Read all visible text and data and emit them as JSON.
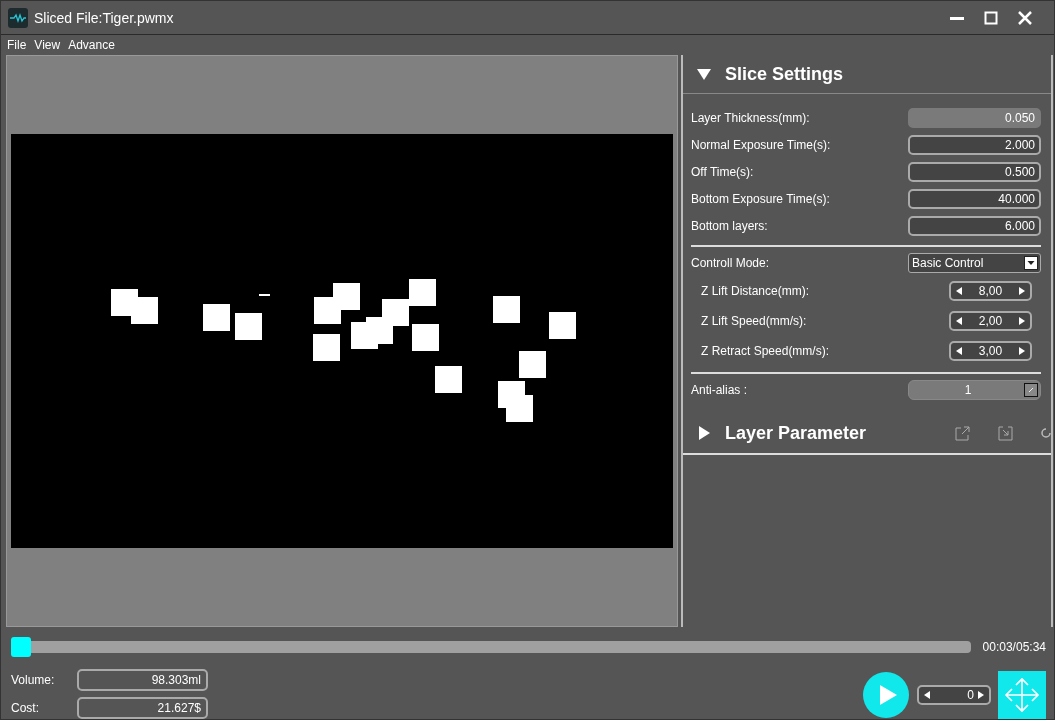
{
  "window": {
    "title": "Sliced File:Tiger.pwmx"
  },
  "menu": [
    "File",
    "View",
    "Advance"
  ],
  "slice_settings": {
    "title": "Slice Settings",
    "expanded": true,
    "fields": [
      {
        "label": "Layer Thickness(mm):",
        "value": "0.050",
        "disabled": true
      },
      {
        "label": "Normal Exposure Time(s):",
        "value": "2.000",
        "disabled": false
      },
      {
        "label": "Off Time(s):",
        "value": "0.500",
        "disabled": false
      },
      {
        "label": "Bottom Exposure Time(s):",
        "value": "40.000",
        "disabled": false
      },
      {
        "label": "Bottom layers:",
        "value": "6.000",
        "disabled": false
      }
    ],
    "control_mode": {
      "label": "Controll Mode:",
      "value": "Basic Control",
      "disabled": false
    },
    "spinners": [
      {
        "label": "Z Lift Distance(mm):",
        "value": "8,00"
      },
      {
        "label": "Z Lift Speed(mm/s):",
        "value": "2,00"
      },
      {
        "label": "Z Retract Speed(mm/s):",
        "value": "3,00"
      }
    ],
    "anti_alias": {
      "label": "Anti-alias :",
      "value": "1",
      "disabled": true
    }
  },
  "layer_parameter": {
    "title": "Layer Parameter",
    "expanded": false
  },
  "playback": {
    "level": 0,
    "time": "00:03/05:34",
    "layer": "0"
  },
  "stats": [
    {
      "label": "Volume:",
      "value": "98.303ml"
    },
    {
      "label": "Cost:",
      "value": "21.627$"
    }
  ]
}
